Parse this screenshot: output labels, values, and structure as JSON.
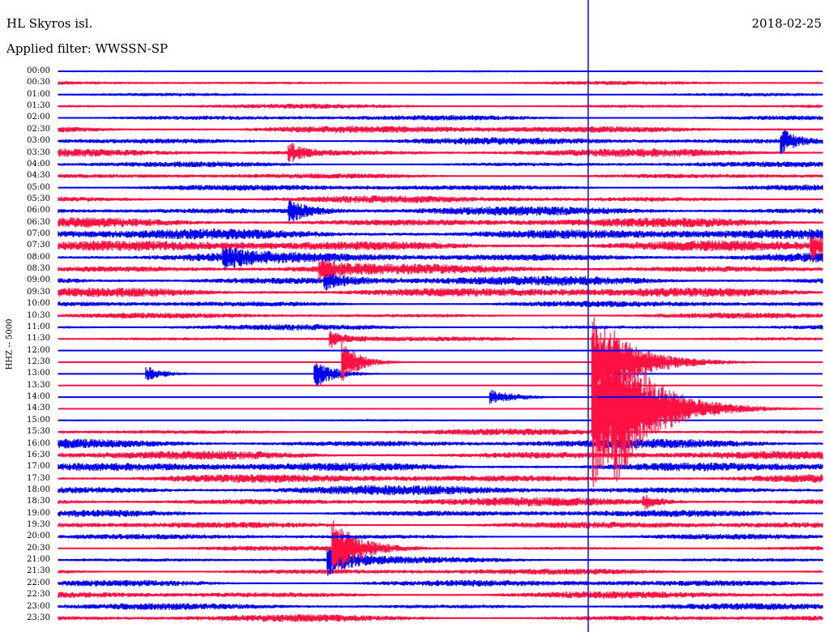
{
  "header": {
    "station": "HL Skyros isl.",
    "filter": "Applied filter: WWSSN-SP",
    "date": "2018-02-25"
  },
  "chart_data": {
    "type": "line",
    "title": "HL Skyros isl.",
    "subtitle": "Applied filter: WWSSN-SP",
    "date": "2018-02-25",
    "ylabel": "HHZ -- 5000",
    "row_interval_minutes": 30,
    "row_labels": [
      "00:00",
      "00:30",
      "01:00",
      "01:30",
      "02:00",
      "02:30",
      "03:00",
      "03:30",
      "04:00",
      "04:30",
      "05:00",
      "05:30",
      "06:00",
      "06:30",
      "07:00",
      "07:30",
      "08:00",
      "08:30",
      "09:00",
      "09:30",
      "10:00",
      "10:30",
      "11:00",
      "11:30",
      "12:00",
      "12:30",
      "13:00",
      "13:30",
      "14:00",
      "14:30",
      "15:00",
      "15:30",
      "16:00",
      "16:30",
      "17:00",
      "17:30",
      "18:00",
      "18:30",
      "19:00",
      "19:30",
      "20:00",
      "20:30",
      "21:00",
      "21:30",
      "22:00",
      "22:30",
      "23:00",
      "23:30"
    ],
    "trace_colors": [
      "#0000ee",
      "#ff1144"
    ],
    "noise_amplitude_relative": [
      0.15,
      0.25,
      0.2,
      0.3,
      0.35,
      0.5,
      0.45,
      0.5,
      0.35,
      0.35,
      0.4,
      0.45,
      0.55,
      0.6,
      0.7,
      0.7,
      0.65,
      0.6,
      0.6,
      0.65,
      0.4,
      0.35,
      0.35,
      0.3,
      0.12,
      0.1,
      0.1,
      0.08,
      0.06,
      0.05,
      0.15,
      0.4,
      0.55,
      0.55,
      0.6,
      0.55,
      0.6,
      0.55,
      0.45,
      0.45,
      0.35,
      0.3,
      0.35,
      0.4,
      0.45,
      0.45,
      0.4,
      0.45
    ],
    "marker_minute": 20.8,
    "marker_color": "#0000cc",
    "events": [
      {
        "row": 12,
        "minute": 9.1,
        "amplitude": 1.2,
        "decay_minutes": 0.8
      },
      {
        "row": 23,
        "minute": 10.7,
        "amplitude": 0.9,
        "decay_minutes": 0.6
      },
      {
        "row": 25,
        "minute": 11.2,
        "amplitude": 2.2,
        "decay_minutes": 0.7
      },
      {
        "row": 26,
        "minute": 3.5,
        "amplitude": 0.8,
        "decay_minutes": 0.7
      },
      {
        "row": 26,
        "minute": 10.1,
        "amplitude": 1.5,
        "decay_minutes": 0.8
      },
      {
        "row": 28,
        "minute": 17.0,
        "amplitude": 0.8,
        "decay_minutes": 1.2
      },
      {
        "row": 25,
        "minute": 21.0,
        "amplitude": 5.5,
        "decay_minutes": 1.5
      },
      {
        "row": 29,
        "minute": 21.0,
        "amplitude": 9.0,
        "decay_minutes": 1.8
      },
      {
        "row": 29,
        "minute": 21.8,
        "amplitude": 3.5,
        "decay_minutes": 1.2
      },
      {
        "row": 41,
        "minute": 10.8,
        "amplitude": 3.0,
        "decay_minutes": 1.0
      },
      {
        "row": 42,
        "minute": 10.6,
        "amplitude": 1.6,
        "decay_minutes": 1.0
      },
      {
        "row": 6,
        "minute": 28.4,
        "amplitude": 1.2,
        "decay_minutes": 0.6
      },
      {
        "row": 7,
        "minute": 9.1,
        "amplitude": 1.0,
        "decay_minutes": 0.6
      },
      {
        "row": 15,
        "minute": 29.6,
        "amplitude": 1.3,
        "decay_minutes": 0.6
      },
      {
        "row": 16,
        "minute": 6.5,
        "amplitude": 1.0,
        "decay_minutes": 0.8
      },
      {
        "row": 17,
        "minute": 10.3,
        "amplitude": 1.0,
        "decay_minutes": 0.8
      },
      {
        "row": 18,
        "minute": 10.5,
        "amplitude": 0.8,
        "decay_minutes": 0.8
      },
      {
        "row": 37,
        "minute": 23.0,
        "amplitude": 0.7,
        "decay_minutes": 0.6
      }
    ]
  }
}
